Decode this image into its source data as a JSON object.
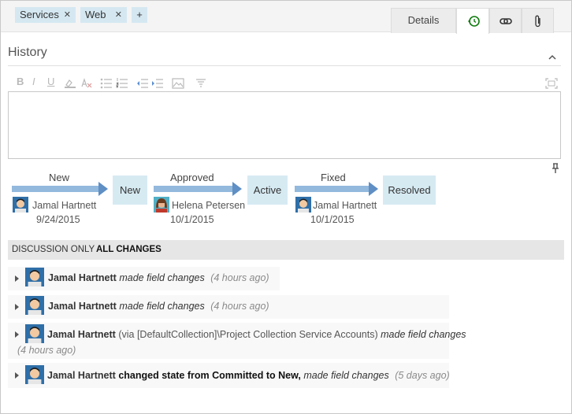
{
  "tags": [
    {
      "label": "Services"
    },
    {
      "label": "Web"
    }
  ],
  "tag_remove_glyph": "✕",
  "tag_add_label": "+",
  "tabs": {
    "details": {
      "label": "Details"
    },
    "history": {
      "icon": "history-icon",
      "active": true
    },
    "links": {
      "icon": "link-icon"
    },
    "attachments": {
      "icon": "paperclip-icon"
    }
  },
  "history": {
    "title": "History",
    "toolbar": {
      "bold": "B",
      "italic": "I",
      "underline": "U",
      "icons": [
        "highlight-icon",
        "clear-format-icon",
        "bullet-list-icon",
        "numbered-list-icon",
        "decrease-indent-icon",
        "increase-indent-icon",
        "image-icon",
        "format-icon",
        "maximize-icon"
      ]
    },
    "editor_value": ""
  },
  "state_flow": [
    {
      "transition": "New",
      "state": "New",
      "by": "Jamal Hartnett",
      "date": "9/24/2015"
    },
    {
      "transition": "Approved",
      "state": "Active",
      "by": "Helena Petersen",
      "date": "10/1/2015"
    },
    {
      "transition": "Fixed",
      "state": "Resolved",
      "by": "Jamal Hartnett",
      "date": "10/1/2015"
    }
  ],
  "filters": {
    "discussion_only": "DISCUSSION ONLY",
    "all_changes": "ALL CHANGES",
    "selected": "all_changes"
  },
  "entries": [
    {
      "author": "Jamal Hartnett",
      "action": "made field changes",
      "time": "(4 hours ago)"
    },
    {
      "author": "Jamal Hartnett",
      "action": "made field changes",
      "time": "(4 hours ago)"
    },
    {
      "author": "Jamal Hartnett",
      "via": "(via [DefaultCollection]\\Project Collection Service Accounts)",
      "action": "made field changes",
      "time": "(4 hours ago)"
    },
    {
      "author": "Jamal Hartnett",
      "state_change": "changed state from Committed to New,",
      "action": "made field changes",
      "time": "(5 days ago)"
    }
  ],
  "colors": {
    "accent": "#0e7a0d",
    "tag_bg": "#d5e8f2",
    "state_bg": "#d6eaf2",
    "arrow": "#93b9dd"
  }
}
